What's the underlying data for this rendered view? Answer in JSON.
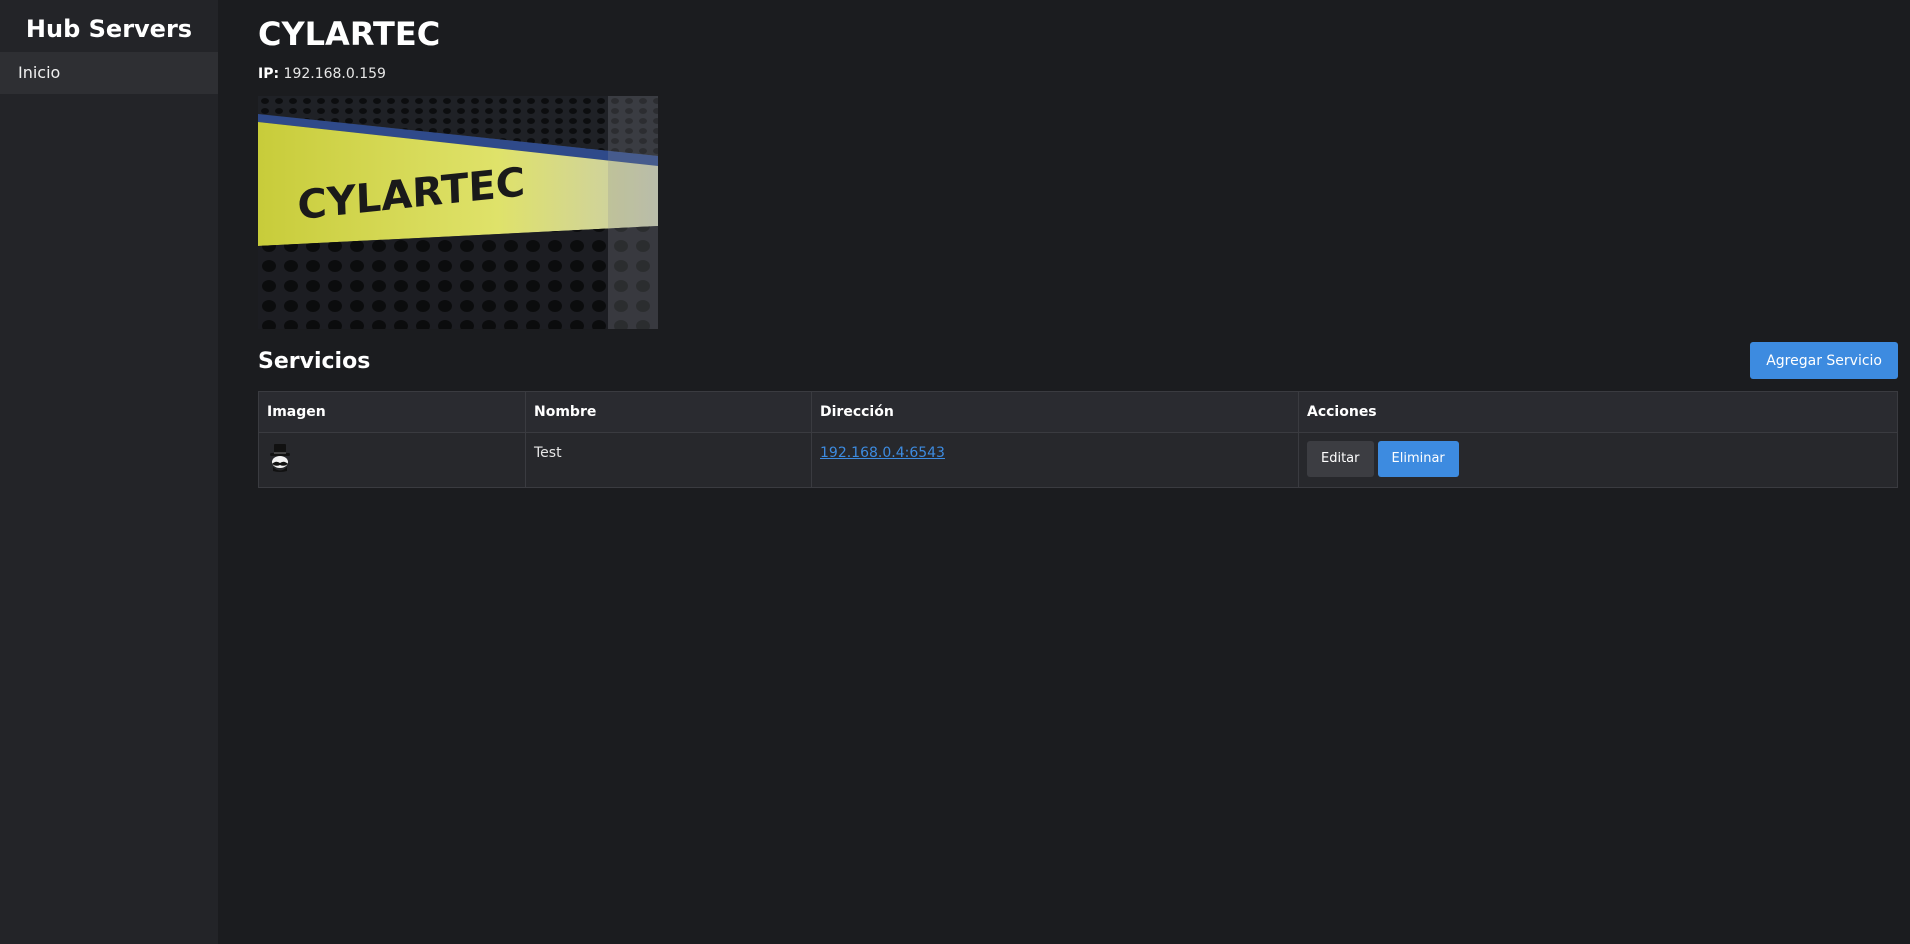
{
  "sidebar": {
    "brand": "Hub Servers",
    "items": [
      {
        "label": "Inicio"
      }
    ]
  },
  "server": {
    "name": "CYLARTEC",
    "ip_label": "IP:",
    "ip_value": "192.168.0.159",
    "image_text": "CYLARTEC"
  },
  "services": {
    "title": "Servicios",
    "add_button": "Agregar Servicio",
    "columns": [
      "Imagen",
      "Nombre",
      "Dirección",
      "Acciones"
    ],
    "rows": [
      {
        "icon": "hat-mustache-icon",
        "name": "Test",
        "address": "192.168.0.4:6543",
        "edit_label": "Editar",
        "delete_label": "Eliminar"
      }
    ]
  },
  "colors": {
    "background": "#1b1c1f",
    "sidebar": "#232428",
    "accent": "#3d8be0"
  }
}
